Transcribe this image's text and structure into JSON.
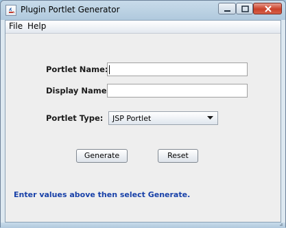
{
  "window": {
    "title": "Plugin Portlet Generator",
    "app_icon": "java-coffee-cup-icon",
    "controls": [
      "minimize-icon",
      "maximize-icon",
      "close-icon"
    ]
  },
  "menubar": {
    "items": [
      {
        "label": "File"
      },
      {
        "label": "Help"
      }
    ]
  },
  "form": {
    "portlet_name_label": "Portlet Name:",
    "portlet_name_value": "",
    "display_name_label": "Display Name:",
    "display_name_value": "",
    "portlet_type_label": "Portlet Type:",
    "portlet_type_value": "JSP Portlet"
  },
  "buttons": {
    "generate_label": "Generate",
    "reset_label": "Reset"
  },
  "status_message": "Enter values above then select Generate.",
  "colors": {
    "status_text": "#1740a8",
    "close_button": "#c9412a",
    "titlebar": "#b0c9dd"
  }
}
